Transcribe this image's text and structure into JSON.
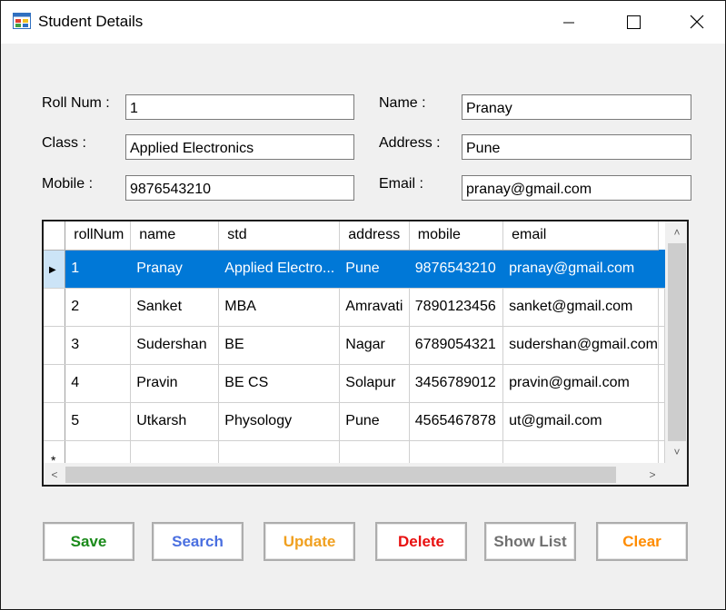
{
  "window": {
    "title": "Student Details"
  },
  "form": {
    "roll_label": "Roll Num :",
    "roll_value": "1",
    "class_label": "Class :",
    "class_value": "Applied Electronics",
    "mobile_label": "Mobile  :",
    "mobile_value": "9876543210",
    "name_label": "Name :",
    "name_value": "Pranay",
    "address_label": "Address :",
    "address_value": "Pune",
    "email_label": "Email  :",
    "email_value": "pranay@gmail.com"
  },
  "grid": {
    "columns": [
      "rollNum",
      "name",
      "std",
      "address",
      "mobile",
      "email"
    ],
    "rows": [
      [
        "1",
        "Pranay",
        "Applied Electro...",
        "Pune",
        "9876543210",
        "pranay@gmail.com"
      ],
      [
        "2",
        "Sanket",
        "MBA",
        "Amravati",
        "7890123456",
        "sanket@gmail.com"
      ],
      [
        "3",
        "Sudershan",
        "BE",
        "Nagar",
        "6789054321",
        "sudershan@gmail.com"
      ],
      [
        "4",
        "Pravin",
        "BE CS",
        "Solapur",
        "3456789012",
        "pravin@gmail.com"
      ],
      [
        "5",
        "Utkarsh",
        "Physology",
        "Pune",
        "4565467878",
        "ut@gmail.com"
      ]
    ],
    "selected_row": 0,
    "current_row_marker": "▶",
    "new_row_marker": "*"
  },
  "buttons": {
    "save": "Save",
    "search": "Search",
    "update": "Update",
    "delete": "Delete",
    "show_list": "Show List",
    "clear": "Clear"
  },
  "colors": {
    "save": "#1a8a1a",
    "search": "#4a6fe0",
    "update": "#f0a020",
    "delete": "#e81010",
    "show_list": "#707070",
    "clear": "#ff8c00",
    "selection": "#0078d7"
  }
}
